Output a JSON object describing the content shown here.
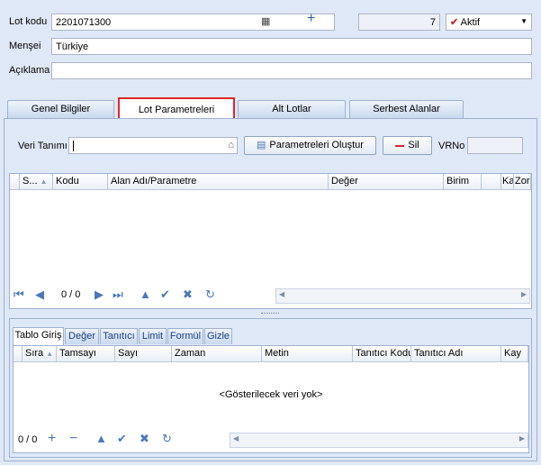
{
  "header": {
    "lot_code_label": "Lot kodu",
    "lot_code_value": "2201071300",
    "number_value": "7",
    "status_value": "Aktif",
    "origin_label": "Menşei",
    "origin_value": "Türkiye",
    "description_label": "Açıklama",
    "description_value": ""
  },
  "tabs": [
    {
      "label": "Genel Bilgiler"
    },
    {
      "label": "Lot Parametreleri"
    },
    {
      "label": "Alt Lotlar"
    },
    {
      "label": "Serbest Alanlar"
    }
  ],
  "lot_params": {
    "veri_tanimi_label": "Veri Tanımı",
    "veri_tanimi_value": "",
    "create_params_label": "Parametreleri Oluştur",
    "delete_label": "Sil",
    "vrno_label": "VRNo",
    "vrno_value": ""
  },
  "param_grid": {
    "columns": [
      "S...",
      "Kodu",
      "Alan Adı/Parametre",
      "Değer",
      "Birim",
      "Ka",
      "Zor"
    ],
    "record_counter": "0 / 0"
  },
  "subtabs": [
    {
      "label": "Tablo Giriş"
    },
    {
      "label": "Değer"
    },
    {
      "label": "Tanıtıcı"
    },
    {
      "label": "Limit"
    },
    {
      "label": "Formül"
    },
    {
      "label": "Gizle"
    }
  ],
  "value_grid": {
    "columns": [
      "Sıra",
      "Tamsayı",
      "Sayı",
      "Zaman",
      "Metin",
      "Tanıtıcı Kodu",
      "Tanıtıcı Adı",
      "Kay"
    ],
    "empty_text": "<Gösterilecek veri yok>",
    "record_counter": "0 / 0"
  },
  "colors": {
    "background": "#dfe8f6",
    "active_tab_highlight": "#e0262a",
    "nav_icon": "#4a78b8",
    "status_check": "#d4292f"
  }
}
